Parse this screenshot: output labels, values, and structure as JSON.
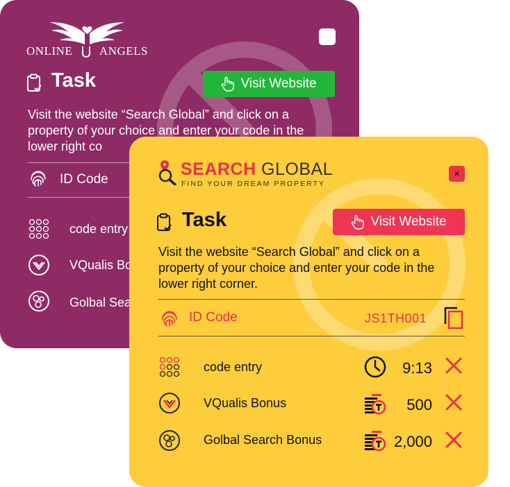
{
  "back_card": {
    "logo": {
      "left": "ONLINE",
      "right": "ANGELS"
    },
    "task_title": "Task",
    "visit_button": "Visit Website",
    "description": "Visit the website “Search Global” and click on a property of your choice and enter your code in the lower right co",
    "id_code_label": "ID Code",
    "rows": [
      {
        "label": "code entry"
      },
      {
        "label": "VQualis Bo"
      },
      {
        "label": "Golbal Sea"
      }
    ]
  },
  "front_card": {
    "logo": {
      "brand_bold": "SEARCH",
      "brand_light": "GLOBAL",
      "tagline": "FIND YOUR DREAM PROPERTY"
    },
    "close_label": "×",
    "task_title": "Task",
    "visit_button": "Visit Website",
    "description": "Visit the website “Search Global” and click on a property of your choice and enter your code in the lower right corner.",
    "id_code_label": "ID Code",
    "id_code_value": "JS1TH001",
    "rows": [
      {
        "label": "code entry",
        "icon": "dots-grid-icon",
        "stat_icon": "clock-icon",
        "value": "9:13"
      },
      {
        "label": "VQualis Bonus",
        "icon": "vqualis-icon",
        "stat_icon": "coin-stack-icon",
        "value": "500"
      },
      {
        "label": "Golbal Search Bonus",
        "icon": "globe-circles-icon",
        "stat_icon": "coin-stack-icon",
        "value": "2,000"
      }
    ]
  },
  "colors": {
    "back_bg": "#8e2a64",
    "front_bg": "#fdcd3c",
    "accent_red": "#e8314a",
    "green_button": "#21b63a",
    "pink_button": "#ef3553"
  }
}
